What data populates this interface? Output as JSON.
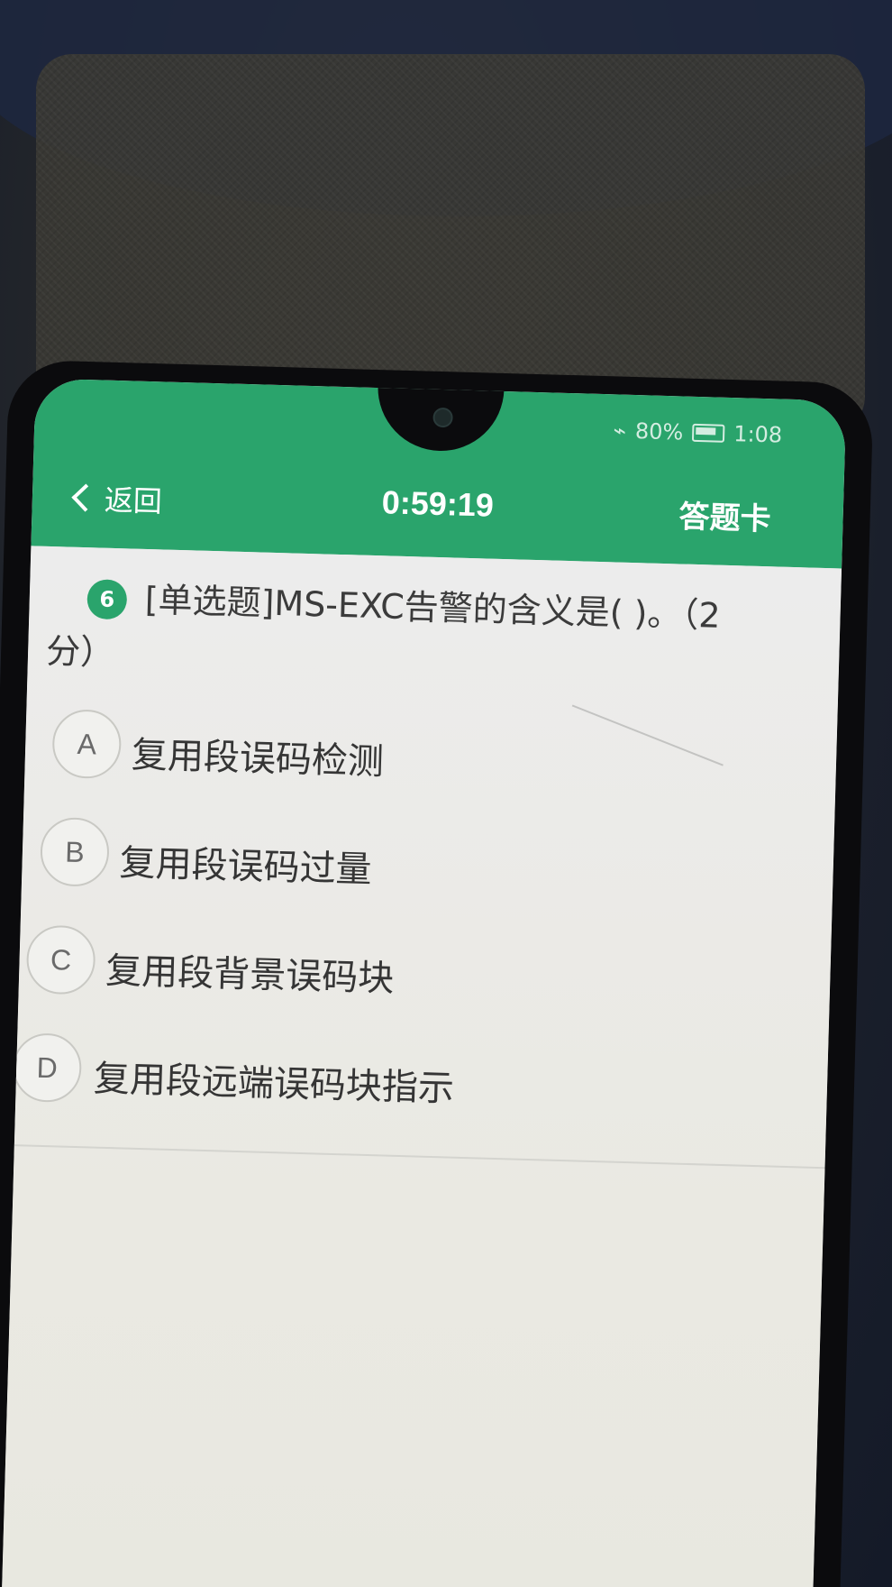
{
  "status_bar": {
    "left_text": "",
    "battery_percent": "80%",
    "time": "1:08"
  },
  "header": {
    "back_label": "返回",
    "timer": "0:59:19",
    "answer_card_label": "答题卡"
  },
  "question": {
    "number": "6",
    "text": "[单选题]MS-EXC告警的含义是( )。（2分）"
  },
  "options": [
    {
      "letter": "A",
      "text": "复用段误码检测"
    },
    {
      "letter": "B",
      "text": "复用段误码过量"
    },
    {
      "letter": "C",
      "text": "复用段背景误码块"
    },
    {
      "letter": "D",
      "text": "复用段远端误码块指示"
    }
  ],
  "colors": {
    "accent": "#2aa46c",
    "background": "#ecece7"
  }
}
